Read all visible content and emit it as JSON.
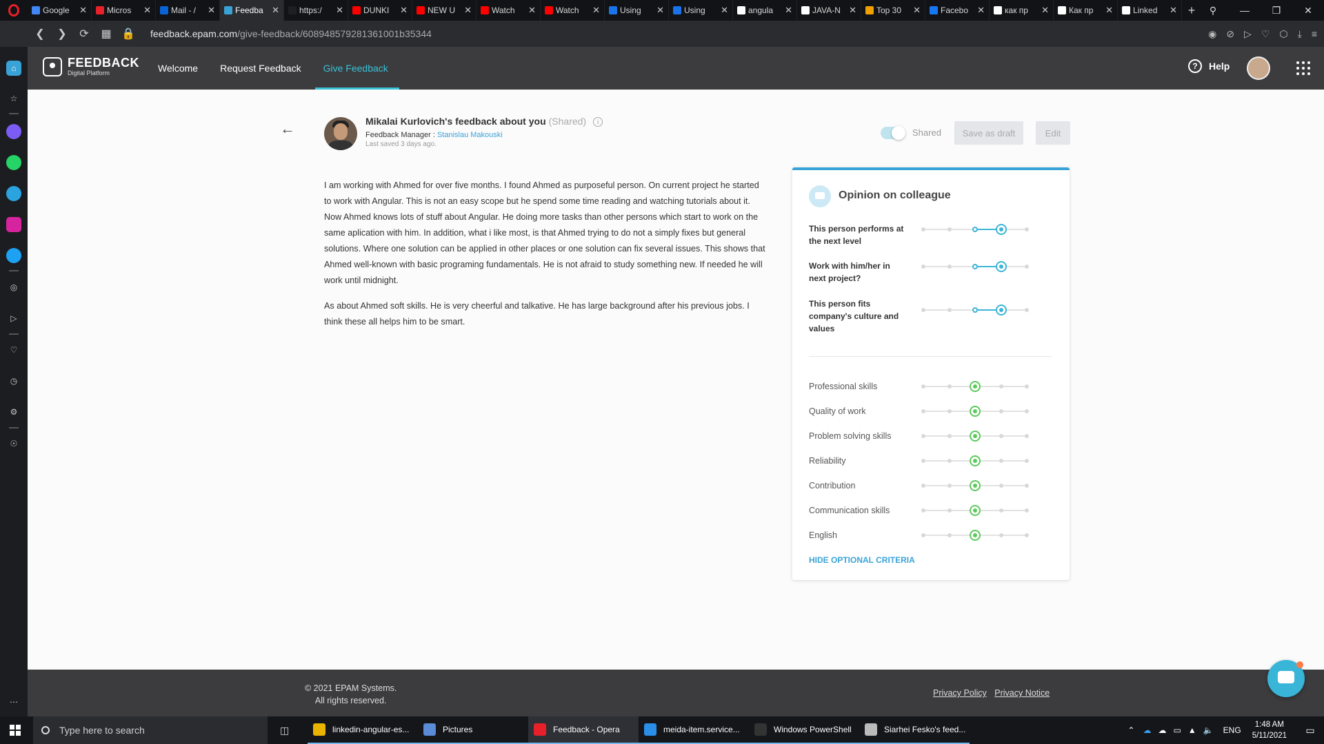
{
  "browser": {
    "tabs": [
      {
        "title": "Google",
        "color": "#4285f4",
        "icon": "google-doc-icon"
      },
      {
        "title": "Micros",
        "color": "#e8202a",
        "icon": "office-icon"
      },
      {
        "title": "Mail - /",
        "color": "#0a64d8",
        "icon": "outlook-icon"
      },
      {
        "title": "Feedba",
        "color": "#39a3d7",
        "icon": "feedback-icon",
        "active": true
      },
      {
        "title": "https:/",
        "color": "#1e1f22",
        "icon": "angular-io-icon"
      },
      {
        "title": "DUNKI",
        "color": "#ff0000",
        "icon": "youtube-icon"
      },
      {
        "title": "NEW U",
        "color": "#ff0000",
        "icon": "youtube-icon"
      },
      {
        "title": "Watch",
        "color": "#ff0000",
        "icon": "youtube-icon"
      },
      {
        "title": "Watch",
        "color": "#ff0000",
        "icon": "youtube-icon"
      },
      {
        "title": "Using",
        "color": "#1a73e8",
        "icon": "video-icon"
      },
      {
        "title": "Using",
        "color": "#1a73e8",
        "icon": "video-icon"
      },
      {
        "title": "angula",
        "color": "#ffffff",
        "icon": "github-icon"
      },
      {
        "title": "JAVA-N",
        "color": "#ffffff",
        "icon": "github-icon"
      },
      {
        "title": "Top 30",
        "color": "#f0a000",
        "icon": "article-icon"
      },
      {
        "title": "Facebo",
        "color": "#1877f2",
        "icon": "facebook-icon"
      },
      {
        "title": "как пр",
        "color": "#ffffff",
        "icon": "google-icon"
      },
      {
        "title": "Как пр",
        "color": "#ffffff",
        "icon": "stackoverflow-icon"
      },
      {
        "title": "Linked",
        "color": "#ffffff",
        "icon": "linkedin-icon"
      }
    ],
    "new_tab": "+",
    "url_domain": "feedback.epam.com",
    "url_path": "/give-feedback/608948579281361001b35344"
  },
  "app": {
    "logo_title": "FEEDBACK",
    "logo_sub": "Digital Platform",
    "nav": [
      "Welcome",
      "Request Feedback",
      "Give Feedback"
    ],
    "active_nav": "Give Feedback",
    "help": "Help"
  },
  "feedback": {
    "title": "Mikalai Kurlovich's feedback about you",
    "status": "(Shared)",
    "manager_label": "Feedback Manager :",
    "manager_name": "Stanislau Makouski",
    "last_saved": "Last saved 3 days ago.",
    "toggle_label": "Shared",
    "draft_button": "Save as draft",
    "edit_button": "Edit",
    "paragraphs": [
      "I am working with Ahmed for over five months. I found Ahmed as purposeful person. On current project he started to work with Angular. This is not an easy scope but he spend some time reading and watching tutorials about it. Now Ahmed knows lots of stuff about Angular. He doing more tasks than other persons which start to work on the same aplication with him. In addition, what i like most, is that Ahmed trying to do not a simply fixes but general solutions. Where one solution can be applied in other places or one solution can fix several issues. This shows that Ahmed well-known with basic programing fundamentals. He is not afraid to study something new. If needed he will work until midnight.",
      "As about Ahmed soft skills. He is very cheerful and talkative. He has large background after his previous jobs. I think these all helps him to be smart."
    ]
  },
  "opinion": {
    "title": "Opinion on colleague",
    "scale_points": 5,
    "primary": [
      {
        "label": "This person performs at the next level",
        "value": 4,
        "prev": 3
      },
      {
        "label": "Work with him/her in next project?",
        "value": 4,
        "prev": 3
      },
      {
        "label": "This person fits company's culture and values",
        "value": 4,
        "prev": 3
      }
    ],
    "criteria": [
      {
        "label": "Professional skills",
        "value": 3
      },
      {
        "label": "Quality of work",
        "value": 3
      },
      {
        "label": "Problem solving skills",
        "value": 3
      },
      {
        "label": "Reliability",
        "value": 3
      },
      {
        "label": "Contribution",
        "value": 3
      },
      {
        "label": "Communication skills",
        "value": 3
      },
      {
        "label": "English",
        "value": 3
      }
    ],
    "hide_optional": "HIDE OPTIONAL CRITERIA"
  },
  "footer": {
    "copyright": "© 2021 EPAM Systems.",
    "rights": "All rights reserved.",
    "privacy_policy": "Privacy Policy",
    "privacy_notice": "Privacy Notice"
  },
  "taskbar": {
    "search_placeholder": "Type here to search",
    "apps": [
      {
        "title": "linkedin-angular-es...",
        "color": "#e8b400",
        "icon": "folder-icon"
      },
      {
        "title": "Pictures",
        "color": "#5a8bd6",
        "icon": "pictures-icon"
      },
      {
        "title": "Feedback - Opera",
        "color": "#e8202a",
        "icon": "opera-icon",
        "active": true
      },
      {
        "title": "meida-item.service...",
        "color": "#2a8ee8",
        "icon": "vscode-icon"
      },
      {
        "title": "Windows PowerShell",
        "color": "#333333",
        "icon": "powershell-icon"
      },
      {
        "title": "Siarhei Fesko's feed...",
        "color": "#bbbbbb",
        "icon": "app-icon"
      }
    ],
    "language": "ENG",
    "time": "1:48 AM",
    "date": "5/11/2021"
  },
  "colors": {
    "accent": "#39a3d7",
    "header_bg": "#3c3c3e",
    "rating_green": "#5cc95c",
    "rating_blue": "#39b5d7"
  }
}
